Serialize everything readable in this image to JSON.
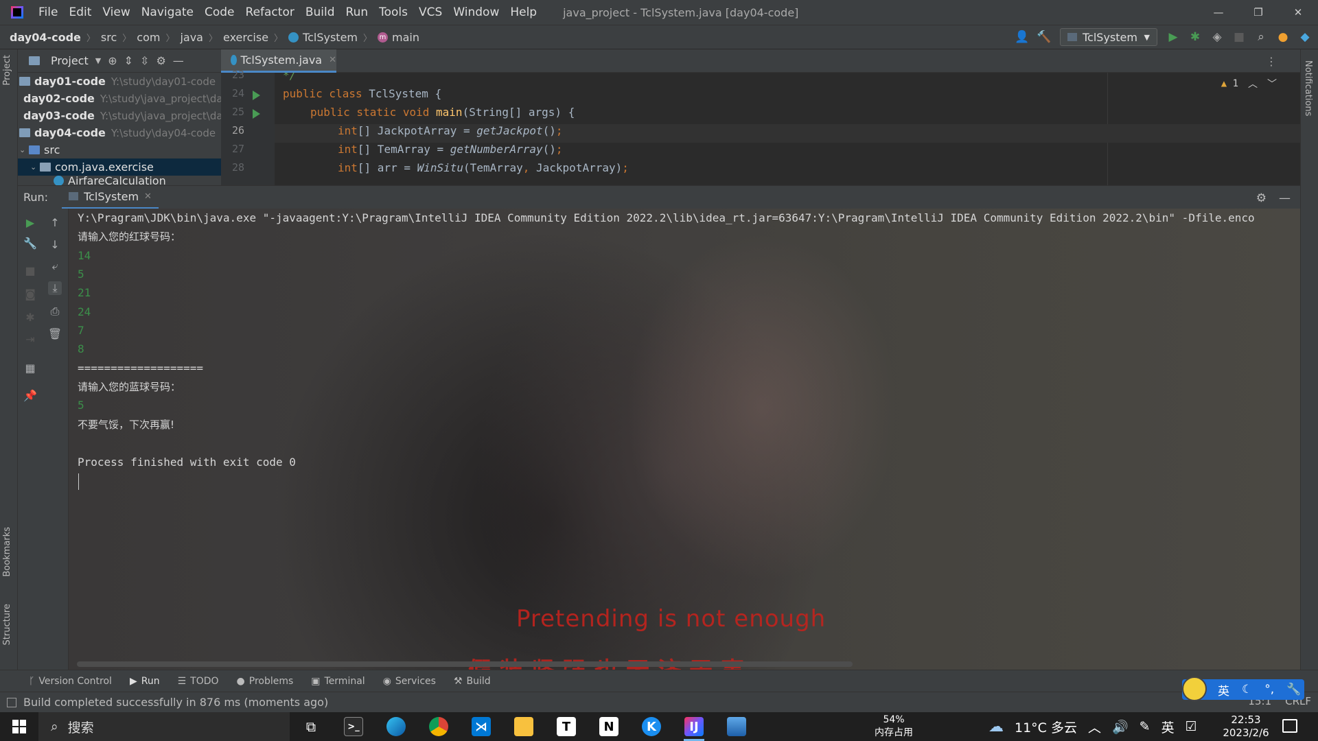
{
  "title_bar": {
    "menus": [
      "File",
      "Edit",
      "View",
      "Navigate",
      "Code",
      "Refactor",
      "Build",
      "Run",
      "Tools",
      "VCS",
      "Window",
      "Help"
    ],
    "window_title": "java_project - TclSystem.java [day04-code]"
  },
  "nav_bar": {
    "breadcrumbs": [
      "day04-code",
      "src",
      "com",
      "java",
      "exercise",
      "TclSystem",
      "main"
    ],
    "run_config": "TclSystem"
  },
  "left_strip": {
    "project": "Project",
    "bookmarks": "Bookmarks",
    "structure": "Structure"
  },
  "right_strip": {
    "notifications": "Notifications"
  },
  "project_panel": {
    "title": "Project",
    "tree": [
      {
        "name": "day01-code",
        "path": "Y:\\study\\day01-code"
      },
      {
        "name": "day02-code",
        "path": "Y:\\study\\java_project\\da"
      },
      {
        "name": "day03-code",
        "path": "Y:\\study\\java_project\\da"
      },
      {
        "name": "day04-code",
        "path": "Y:\\study\\day04-code"
      },
      {
        "name": "src",
        "path": ""
      },
      {
        "name": "com.java.exercise",
        "path": ""
      },
      {
        "name": "AirfareCalculation",
        "path": ""
      }
    ]
  },
  "editor": {
    "tab": "TclSystem.java",
    "warnings": "1",
    "lines": [
      {
        "num": "23",
        "text": "*/"
      },
      {
        "num": "24",
        "text": "public class TclSystem {"
      },
      {
        "num": "25",
        "text": "public static void main(String[] args) {"
      },
      {
        "num": "26",
        "text": "int[] JackpotArray = getJackpot();"
      },
      {
        "num": "27",
        "text": "int[] TemArray = getNumberArray();"
      },
      {
        "num": "28",
        "text": "int[] arr = WinSitu(TemArray, JackpotArray);"
      }
    ]
  },
  "run_panel": {
    "label": "Run:",
    "tab": "TclSystem",
    "console": [
      {
        "text": "Y:\\Pragram\\JDK\\bin\\java.exe \"-javaagent:Y:\\Pragram\\IntelliJ IDEA Community Edition 2022.2\\lib\\idea_rt.jar=63647:Y:\\Pragram\\IntelliJ IDEA Community Edition 2022.2\\bin\" -Dfile.enco",
        "kind": "out"
      },
      {
        "text": "请输入您的红球号码：",
        "kind": "cjk"
      },
      {
        "text": "14",
        "kind": "input"
      },
      {
        "text": "5",
        "kind": "input"
      },
      {
        "text": "21",
        "kind": "input"
      },
      {
        "text": "24",
        "kind": "input"
      },
      {
        "text": "7",
        "kind": "input"
      },
      {
        "text": "8",
        "kind": "input"
      },
      {
        "text": "===================",
        "kind": "out"
      },
      {
        "text": "请输入您的蓝球号码：",
        "kind": "cjk"
      },
      {
        "text": "5",
        "kind": "input"
      },
      {
        "text": "不要气馁，下次再赢!",
        "kind": "cjk"
      },
      {
        "text": "",
        "kind": "out"
      },
      {
        "text": "Process finished with exit code 0",
        "kind": "out"
      }
    ],
    "wallpaper_text_en": "Pretending is not enough",
    "wallpaper_text_cn": "假装坚强也无济于事"
  },
  "tool_windows": [
    "Version Control",
    "Run",
    "TODO",
    "Problems",
    "Terminal",
    "Services",
    "Build"
  ],
  "status_bar": {
    "message": "Build completed successfully in 876 ms (moments ago)",
    "position": "15:1",
    "line_sep": "CRLF"
  },
  "ime": {
    "lang": "英"
  },
  "taskbar": {
    "search": "搜索",
    "memory_percent": "54%",
    "memory_label": "内存占用",
    "weather": "11°C 多云",
    "input_lang": "英",
    "time": "22:53",
    "date": "2023/2/6"
  },
  "colors": {
    "accent": "#4a88c7",
    "run_green": "#499c54",
    "console_input": "#3c8f4a",
    "overlay_red": "#c2231d"
  }
}
